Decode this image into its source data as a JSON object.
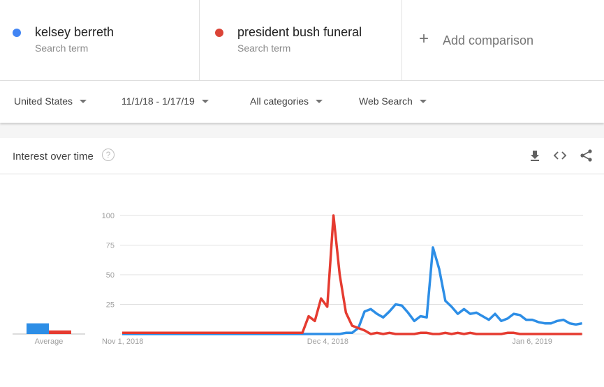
{
  "terms": [
    {
      "name": "kelsey berreth",
      "subtitle": "Search term",
      "color": "#4285f4"
    },
    {
      "name": "president bush funeral",
      "subtitle": "Search term",
      "color": "#db4437"
    }
  ],
  "add_comparison": {
    "icon": "plus-icon",
    "label": "Add comparison"
  },
  "filters": {
    "region": "United States",
    "date_range": "11/1/18 - 1/17/19",
    "category": "All categories",
    "search_type": "Web Search"
  },
  "card": {
    "title": "Interest over time",
    "help_icon": "?",
    "actions": [
      "download-icon",
      "embed-icon",
      "share-icon"
    ]
  },
  "chart_data": {
    "type": "line",
    "title": "Interest over time",
    "ylim": [
      0,
      100
    ],
    "yticks": [
      25,
      50,
      75,
      100
    ],
    "ytick_labels": [
      "25",
      "50",
      "75",
      "100"
    ],
    "xtick_labels": [
      {
        "label": "Nov 1, 2018",
        "day": 0
      },
      {
        "label": "Dec 4, 2018",
        "day": 33
      },
      {
        "label": "Jan 6, 2019",
        "day": 66
      }
    ],
    "grid": true,
    "average_label": "Average",
    "averages": [
      {
        "name": "kelsey berreth",
        "value": 9
      },
      {
        "name": "president bush funeral",
        "value": 3
      }
    ],
    "series": [
      {
        "name": "kelsey berreth",
        "color": "#2d8ee6",
        "values": [
          0,
          0,
          0,
          0,
          0,
          0,
          0,
          0,
          0,
          0,
          0,
          0,
          0,
          0,
          0,
          0,
          0,
          0,
          0,
          0,
          0,
          0,
          0,
          0,
          0,
          0,
          0,
          0,
          0,
          0,
          0,
          0,
          0,
          0,
          0,
          0,
          1,
          1,
          5,
          19,
          21,
          17,
          14,
          19,
          25,
          24,
          18,
          11,
          15,
          14,
          73,
          55,
          28,
          23,
          17,
          21,
          17,
          18,
          15,
          12,
          17,
          11,
          13,
          17,
          16,
          12,
          12,
          10,
          9,
          9,
          11,
          12,
          9,
          8,
          9
        ]
      },
      {
        "name": "president bush funeral",
        "color": "#e53b30",
        "values": [
          1,
          1,
          1,
          1,
          1,
          1,
          1,
          1,
          1,
          1,
          1,
          1,
          1,
          1,
          1,
          1,
          1,
          1,
          1,
          1,
          1,
          1,
          1,
          1,
          1,
          1,
          1,
          1,
          1,
          1,
          15,
          11,
          30,
          23,
          100,
          50,
          18,
          7,
          5,
          3,
          0,
          1,
          0,
          1,
          0,
          0,
          0,
          0,
          1,
          1,
          0,
          0,
          1,
          0,
          1,
          0,
          1,
          0,
          0,
          0,
          0,
          0,
          1,
          1,
          0,
          0,
          0,
          0,
          0,
          0,
          0,
          0,
          0,
          0,
          0
        ]
      }
    ]
  }
}
